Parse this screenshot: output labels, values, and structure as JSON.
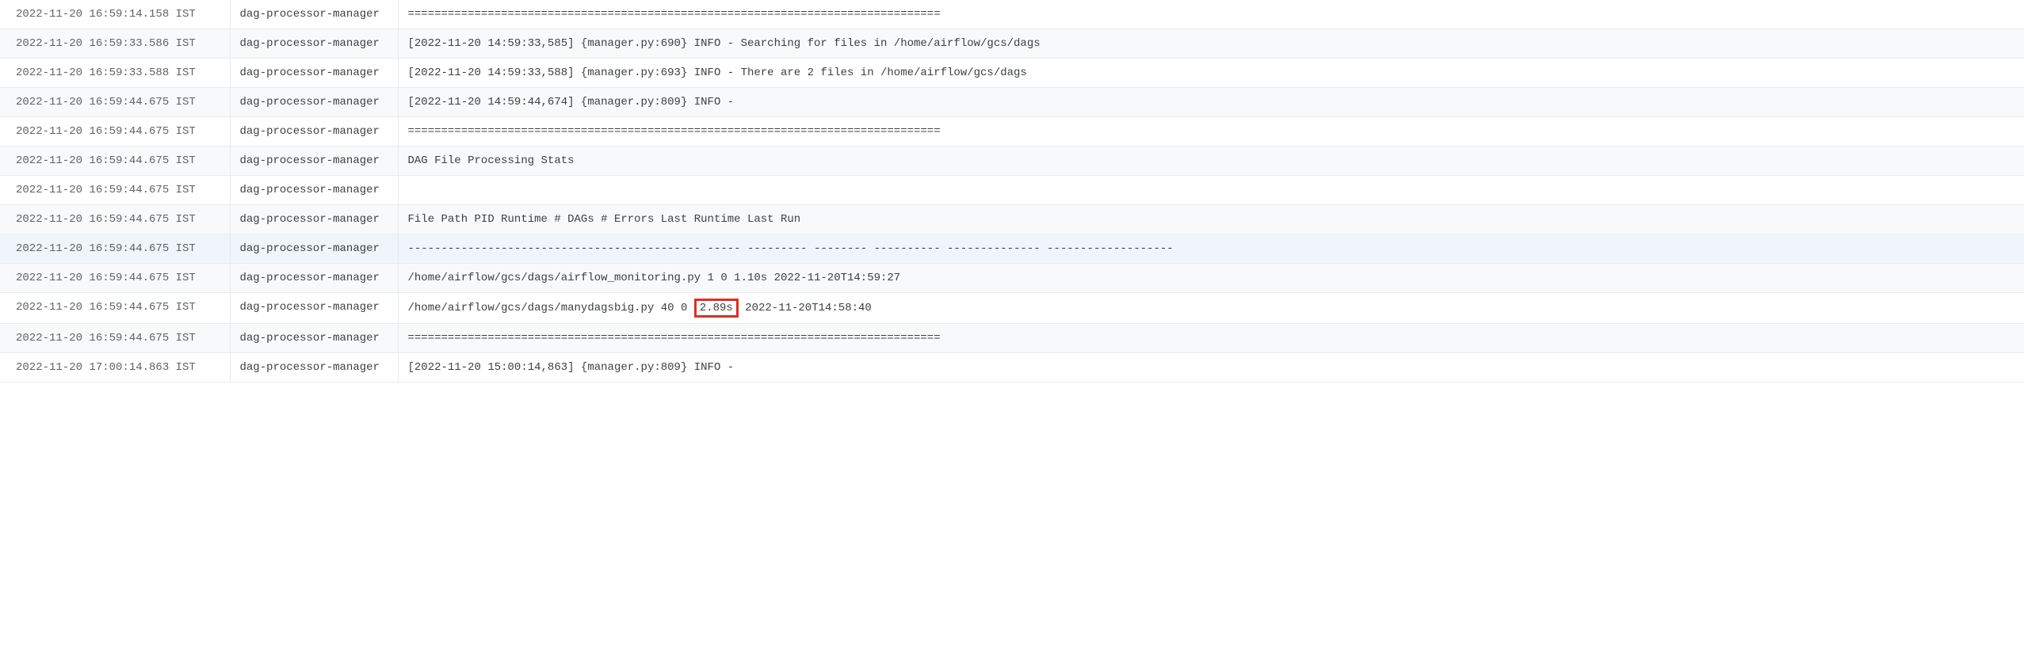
{
  "logs": [
    {
      "timestamp": "2022-11-20 16:59:14.158 IST",
      "source": "dag-processor-manager",
      "message": "================================================================================",
      "highlighted": false
    },
    {
      "timestamp": "2022-11-20 16:59:33.586 IST",
      "source": "dag-processor-manager",
      "message": "[2022-11-20 14:59:33,585] {manager.py:690} INFO - Searching for files in /home/airflow/gcs/dags",
      "highlighted": false
    },
    {
      "timestamp": "2022-11-20 16:59:33.588 IST",
      "source": "dag-processor-manager",
      "message": "[2022-11-20 14:59:33,588] {manager.py:693} INFO - There are 2 files in /home/airflow/gcs/dags",
      "highlighted": false
    },
    {
      "timestamp": "2022-11-20 16:59:44.675 IST",
      "source": "dag-processor-manager",
      "message": "[2022-11-20 14:59:44,674] {manager.py:809} INFO - ",
      "highlighted": false
    },
    {
      "timestamp": "2022-11-20 16:59:44.675 IST",
      "source": "dag-processor-manager",
      "message": "================================================================================",
      "highlighted": false
    },
    {
      "timestamp": "2022-11-20 16:59:44.675 IST",
      "source": "dag-processor-manager",
      "message": "DAG File Processing Stats",
      "highlighted": false
    },
    {
      "timestamp": "2022-11-20 16:59:44.675 IST",
      "source": "dag-processor-manager",
      "message": "",
      "highlighted": false
    },
    {
      "timestamp": "2022-11-20 16:59:44.675 IST",
      "source": "dag-processor-manager",
      "message": "File Path PID Runtime # DAGs # Errors Last Runtime Last Run",
      "highlighted": false
    },
    {
      "timestamp": "2022-11-20 16:59:44.675 IST",
      "source": "dag-processor-manager",
      "message": "-------------------------------------------- ----- --------- -------- ---------- -------------- -------------------",
      "highlighted": true
    },
    {
      "timestamp": "2022-11-20 16:59:44.675 IST",
      "source": "dag-processor-manager",
      "message": "/home/airflow/gcs/dags/airflow_monitoring.py 1 0 1.10s 2022-11-20T14:59:27",
      "highlighted": false
    },
    {
      "timestamp": "2022-11-20 16:59:44.675 IST",
      "source": "dag-processor-manager",
      "message_pre": "/home/airflow/gcs/dags/manydagsbig.py 40 0 ",
      "message_boxed": "2.89s",
      "message_post": " 2022-11-20T14:58:40",
      "has_box": true,
      "highlighted": false
    },
    {
      "timestamp": "2022-11-20 16:59:44.675 IST",
      "source": "dag-processor-manager",
      "message": "================================================================================",
      "highlighted": false
    },
    {
      "timestamp": "2022-11-20 17:00:14.863 IST",
      "source": "dag-processor-manager",
      "message": "[2022-11-20 15:00:14,863] {manager.py:809} INFO - ",
      "highlighted": false
    }
  ]
}
